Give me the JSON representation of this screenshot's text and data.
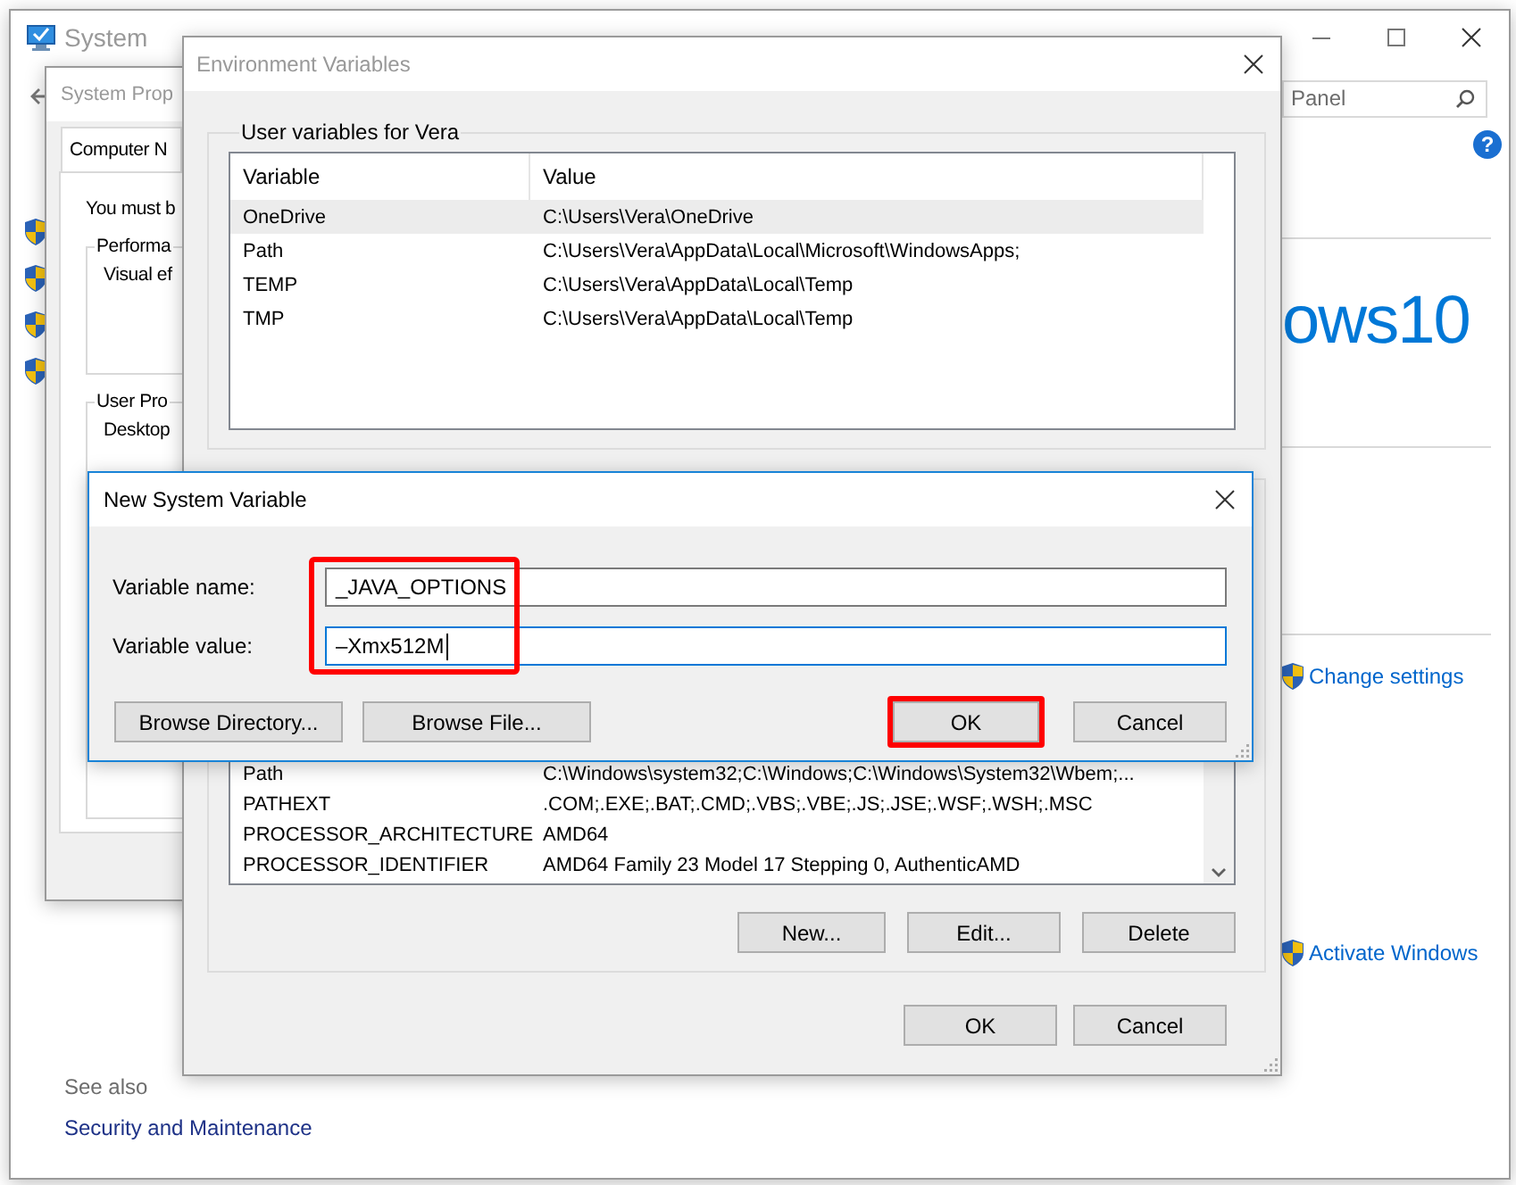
{
  "system_window": {
    "title": "System",
    "search": {
      "value": "Panel"
    },
    "help_glyph": "?",
    "heading_fragment": "ows10",
    "links": [
      {
        "label": "Change settings"
      },
      {
        "label": "Activate Windows"
      }
    ],
    "see_also": {
      "heading": "See also",
      "links": [
        "Security and Maintenance"
      ]
    }
  },
  "system_properties": {
    "title": "System Prop",
    "tabs": [
      {
        "label": "Computer N",
        "selected": true
      }
    ],
    "notice": "You must b",
    "groups": [
      {
        "title": "Performa",
        "text": "Visual ef"
      },
      {
        "title": "User Pro",
        "text": "Desktop"
      }
    ]
  },
  "environment_variables": {
    "title": "Environment Variables",
    "user_group": {
      "title": "User variables for Vera",
      "columns": [
        "Variable",
        "Value"
      ],
      "rows": [
        {
          "variable": "OneDrive",
          "value": "C:\\Users\\Vera\\OneDrive",
          "selected": true
        },
        {
          "variable": "Path",
          "value": "C:\\Users\\Vera\\AppData\\Local\\Microsoft\\WindowsApps;",
          "selected": false
        },
        {
          "variable": "TEMP",
          "value": "C:\\Users\\Vera\\AppData\\Local\\Temp",
          "selected": false
        },
        {
          "variable": "TMP",
          "value": "C:\\Users\\Vera\\AppData\\Local\\Temp",
          "selected": false
        }
      ]
    },
    "system_rows": [
      {
        "variable": "Path",
        "value": "C:\\Windows\\system32;C:\\Windows;C:\\Windows\\System32\\Wbem;...",
        "selected": false
      },
      {
        "variable": "PATHEXT",
        "value": ".COM;.EXE;.BAT;.CMD;.VBS;.VBE;.JS;.JSE;.WSF;.WSH;.MSC",
        "selected": false
      },
      {
        "variable": "PROCESSOR_ARCHITECTURE",
        "value": "AMD64",
        "selected": false
      },
      {
        "variable": "PROCESSOR_IDENTIFIER",
        "value": "AMD64 Family 23 Model 17 Stepping 0, AuthenticAMD",
        "selected": false
      }
    ],
    "system_buttons": [
      "New...",
      "Edit...",
      "Delete"
    ],
    "buttons": [
      "OK",
      "Cancel"
    ]
  },
  "new_variable_dialog": {
    "title": "New System Variable",
    "fields_highlighted": true,
    "fields": [
      {
        "label": "Variable name:",
        "value": "_JAVA_OPTIONS",
        "focused": false
      },
      {
        "label": "Variable value:",
        "value": "–Xmx512M",
        "focused": true
      }
    ],
    "browse_buttons": [
      "Browse Directory...",
      "Browse File..."
    ],
    "buttons": [
      {
        "label": "OK",
        "highlighted": true
      },
      {
        "label": "Cancel",
        "highlighted": false
      }
    ]
  }
}
